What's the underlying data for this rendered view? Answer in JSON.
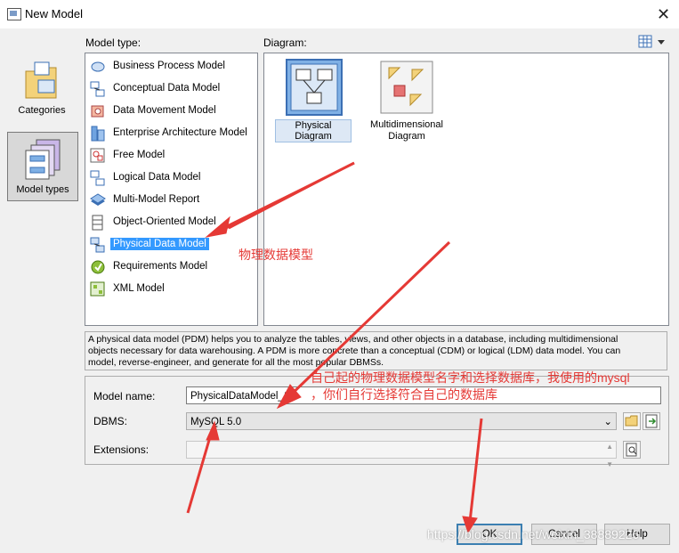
{
  "window": {
    "title": "New Model"
  },
  "labels": {
    "model_type": "Model type:",
    "diagram": "Diagram:"
  },
  "categories": [
    {
      "label": "Categories"
    },
    {
      "label": "Model types",
      "selected": true
    }
  ],
  "model_types": [
    "Business Process Model",
    "Conceptual Data Model",
    "Data Movement Model",
    "Enterprise Architecture Model",
    "Free Model",
    "Logical Data Model",
    "Multi-Model Report",
    "Object-Oriented Model",
    "Physical Data Model",
    "Requirements Model",
    "XML Model"
  ],
  "selected_model_type": "Physical Data Model",
  "diagrams": [
    {
      "label": "Physical Diagram",
      "selected": true
    },
    {
      "label_line1": "Multidimensional",
      "label_line2": "Diagram"
    }
  ],
  "description": {
    "line1": "A physical data model (PDM) helps you to analyze the tables, views, and other objects in a database, including multidimensional",
    "line2": "objects necessary for data warehousing. A PDM is more concrete than a conceptual (CDM) or logical (LDM) data model. You can",
    "line3": "model, reverse-engineer, and generate for all the most popular DBMSs."
  },
  "form": {
    "model_name_label": "Model name:",
    "model_name_value": "PhysicalDataModel_1",
    "dbms_label": "DBMS:",
    "dbms_value": "MySQL 5.0",
    "extensions_label": "Extensions:",
    "extensions_value": ""
  },
  "buttons": {
    "ok": "OK",
    "cancel": "Cancel",
    "help": "Help"
  },
  "annotations": {
    "a1": "物理数据模型",
    "a2": "自己起的物理数据模型名字和选择数据库，我使用的mysql",
    "a3": "，你们自行选择符合自己的数据库"
  },
  "watermark": "https://blog.csdn.net/weixin_38889226",
  "colors": {
    "selection": "#3399ff",
    "annotation": "#e53935"
  }
}
